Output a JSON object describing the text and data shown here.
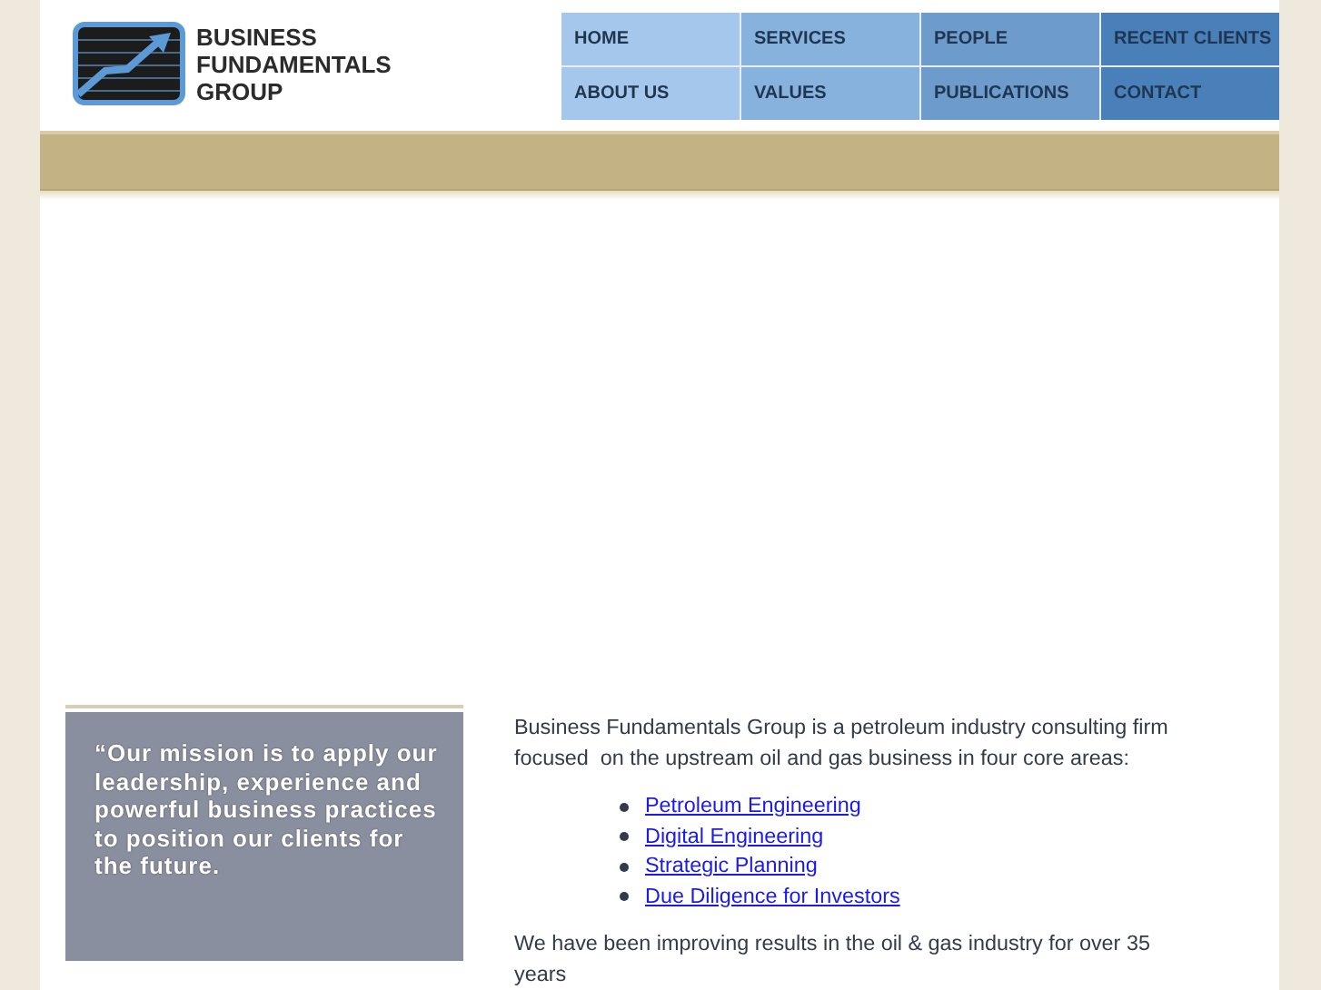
{
  "logo": {
    "lines": [
      "BUSINESS",
      "FUNDAMENTALS",
      "GROUP"
    ]
  },
  "nav": [
    "HOME",
    "SERVICES",
    "PEOPLE",
    "RECENT CLIENTS",
    "ABOUT US",
    "VALUES",
    "PUBLICATIONS",
    "CONTACT"
  ],
  "mission": {
    "quote": "“Our mission is to apply our leadership, experience and powerful business practices to position our clients for the future."
  },
  "intro": {
    "text": "Business Fundamentals Group is a petroleum industry consulting firm focused  on the upstream oil and gas business in four core areas:",
    "links": [
      "Petroleum Engineering",
      "Digital Engineering",
      "Strategic Planning",
      "Due Diligence for Investors"
    ],
    "more": "We have been improving results in the oil & gas industry for over 35 years"
  }
}
